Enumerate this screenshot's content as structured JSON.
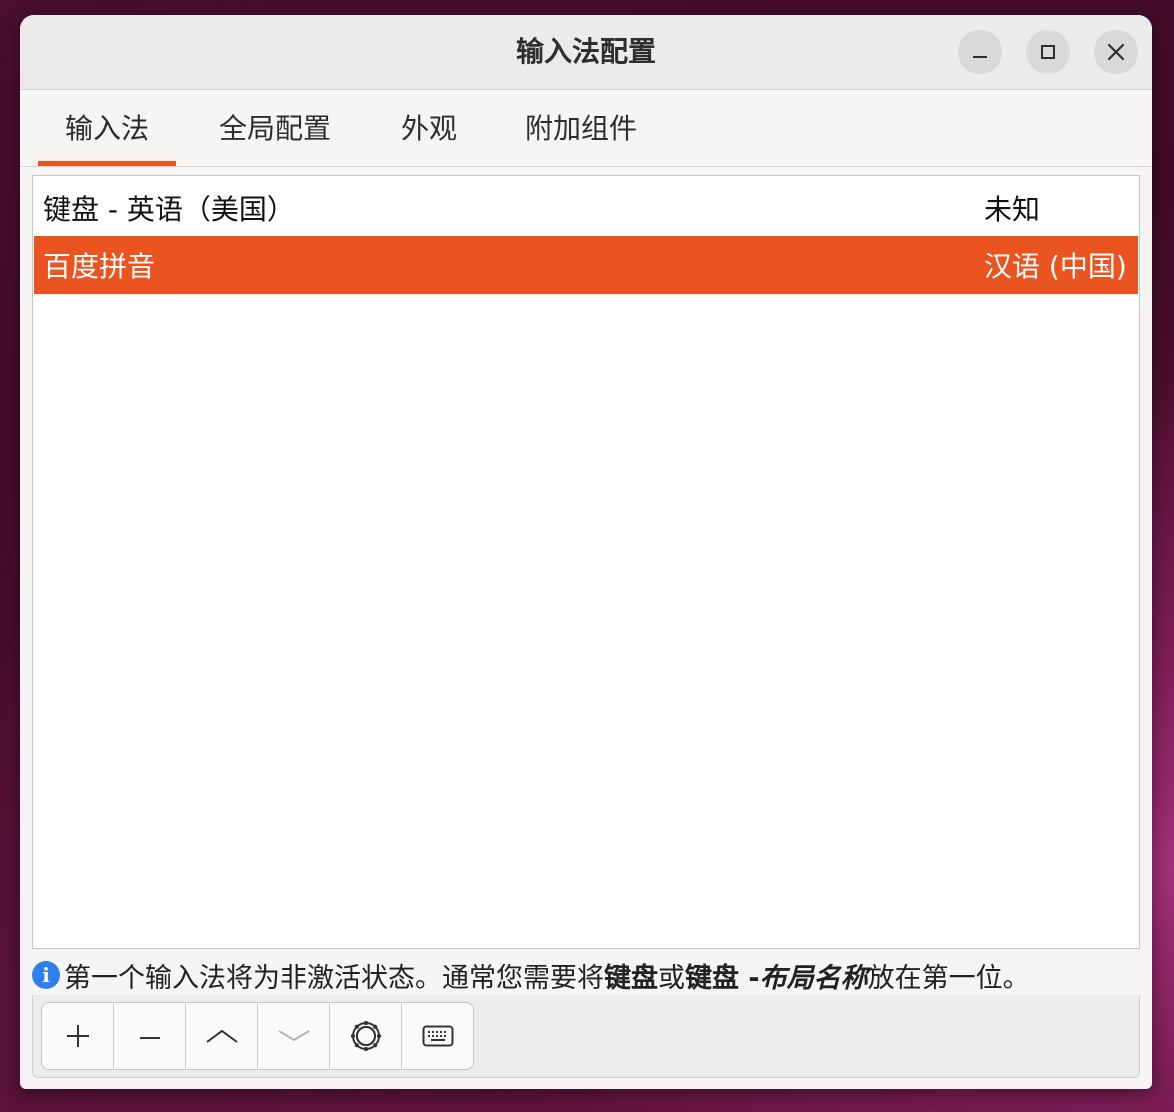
{
  "window": {
    "title": "输入法配置"
  },
  "tabs": [
    {
      "label": "输入法",
      "active": true
    },
    {
      "label": "全局配置",
      "active": false
    },
    {
      "label": "外观",
      "active": false
    },
    {
      "label": "附加组件",
      "active": false
    }
  ],
  "input_methods": [
    {
      "name": "键盘 - 英语（美国）",
      "language": "未知",
      "selected": false
    },
    {
      "name": "百度拼音",
      "language": "汉语 (中国)",
      "selected": true
    }
  ],
  "info": {
    "text_1": "第一个输入法将为非激活状态。通常您需要将",
    "bold_1": "键盘",
    "text_2": "或",
    "bold_2": "键盘 - ",
    "italic_bold": "布局名称",
    "text_3": "放在第一位。"
  },
  "toolbar": {
    "add": "add-icon",
    "remove": "remove-icon",
    "move_up": "chevron-up-icon",
    "move_down": "chevron-down-icon",
    "configure": "gear-icon",
    "keyboard_layout": "keyboard-icon"
  },
  "colors": {
    "accent": "#e95420",
    "info": "#2f80ed"
  }
}
